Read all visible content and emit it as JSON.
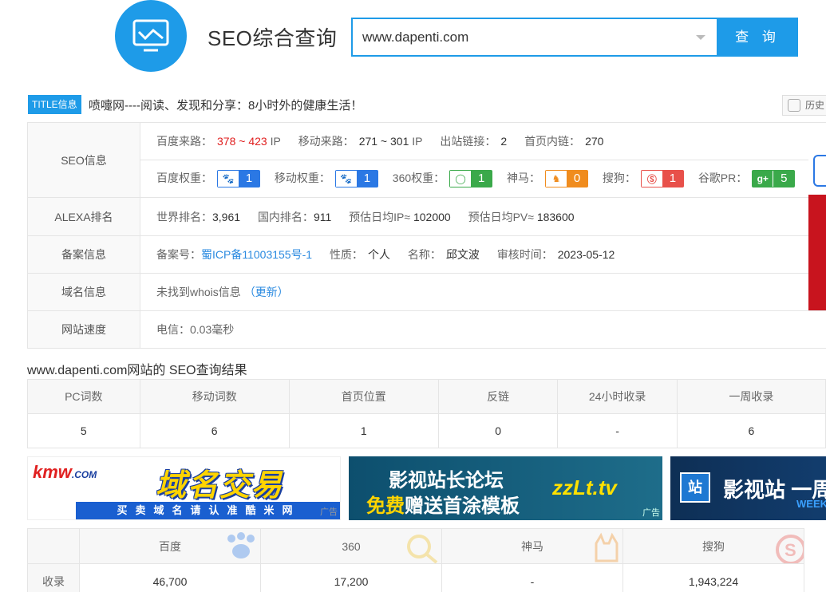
{
  "header": {
    "app_title": "SEO综合查询",
    "search_value": "www.dapenti.com",
    "search_button": "查 询"
  },
  "title_info": {
    "tag": "TITLE信息",
    "text": "喷嚏网----阅读、发现和分享：8小时外的健康生活！",
    "history": "历史"
  },
  "info": {
    "seo": {
      "label": "SEO信息",
      "baidu_source_label": "百度来路：",
      "baidu_source": "378 ~ 423",
      "baidu_source_unit": "IP",
      "mobile_source_label": "移动来路：",
      "mobile_source": "271 ~ 301",
      "mobile_source_unit": "IP",
      "outlinks_label": "出站链接：",
      "outlinks": "2",
      "inlinks_label": "首页内链：",
      "inlinks": "270",
      "baidu_weight_label": "百度权重：",
      "baidu_weight": "1",
      "mobile_weight_label": "移动权重：",
      "mobile_weight": "1",
      "w360_label": "360权重：",
      "w360": "1",
      "shenma_label": "神马：",
      "shenma": "0",
      "sogou_label": "搜狗：",
      "sogou": "1",
      "google_label": "谷歌PR：",
      "google": "5"
    },
    "alexa": {
      "label": "ALEXA排名",
      "world_label": "世界排名：",
      "world": "3,961",
      "domestic_label": "国内排名：",
      "domestic": "911",
      "ip_label": "预估日均IP≈",
      "ip": "102000",
      "pv_label": "预估日均PV≈",
      "pv": "183600"
    },
    "icp": {
      "label": "备案信息",
      "no_label": "备案号：",
      "no": "蜀ICP备11003155号-1",
      "nature_label": "性质：",
      "nature": "个人",
      "name_label": "名称：",
      "name": "邱文波",
      "date_label": "审核时间：",
      "date": "2023-05-12"
    },
    "domain": {
      "label": "域名信息",
      "text": "未找到whois信息",
      "update": "（更新）"
    },
    "speed": {
      "label": "网站速度",
      "text": "电信：0.03毫秒"
    }
  },
  "result": {
    "title": "www.dapenti.com网站的 SEO查询结果",
    "headers": [
      "PC词数",
      "移动词数",
      "首页位置",
      "反链",
      "24小时收录",
      "一周收录"
    ],
    "values": [
      "5",
      "6",
      "1",
      "0",
      "-",
      "6"
    ]
  },
  "ads": {
    "ad1_brand": "kmw",
    "ad1_brand_suffix": ".COM",
    "ad1_big": "域名交易",
    "ad1_bar": "买卖域名请认准酷米网",
    "ad2_line1": "影视站长论坛",
    "ad2_line2a": "免费",
    "ad2_line2b": "赠送首涂模板",
    "ad2_domain": "zzLt.tv",
    "ad3_badge": "站",
    "ad3_title": "影视站 一周",
    "ad3_sub": "WEEK",
    "ad_tag": "广告"
  },
  "engines": {
    "headers": [
      "",
      "百度",
      "360",
      "神马",
      "搜狗"
    ],
    "row_label": "收录",
    "values": [
      "46,700",
      "17,200",
      "-",
      "1,943,224"
    ]
  },
  "colors": {
    "accent": "#1e9be8",
    "red": "#e02020",
    "link": "#2a8ae0"
  }
}
